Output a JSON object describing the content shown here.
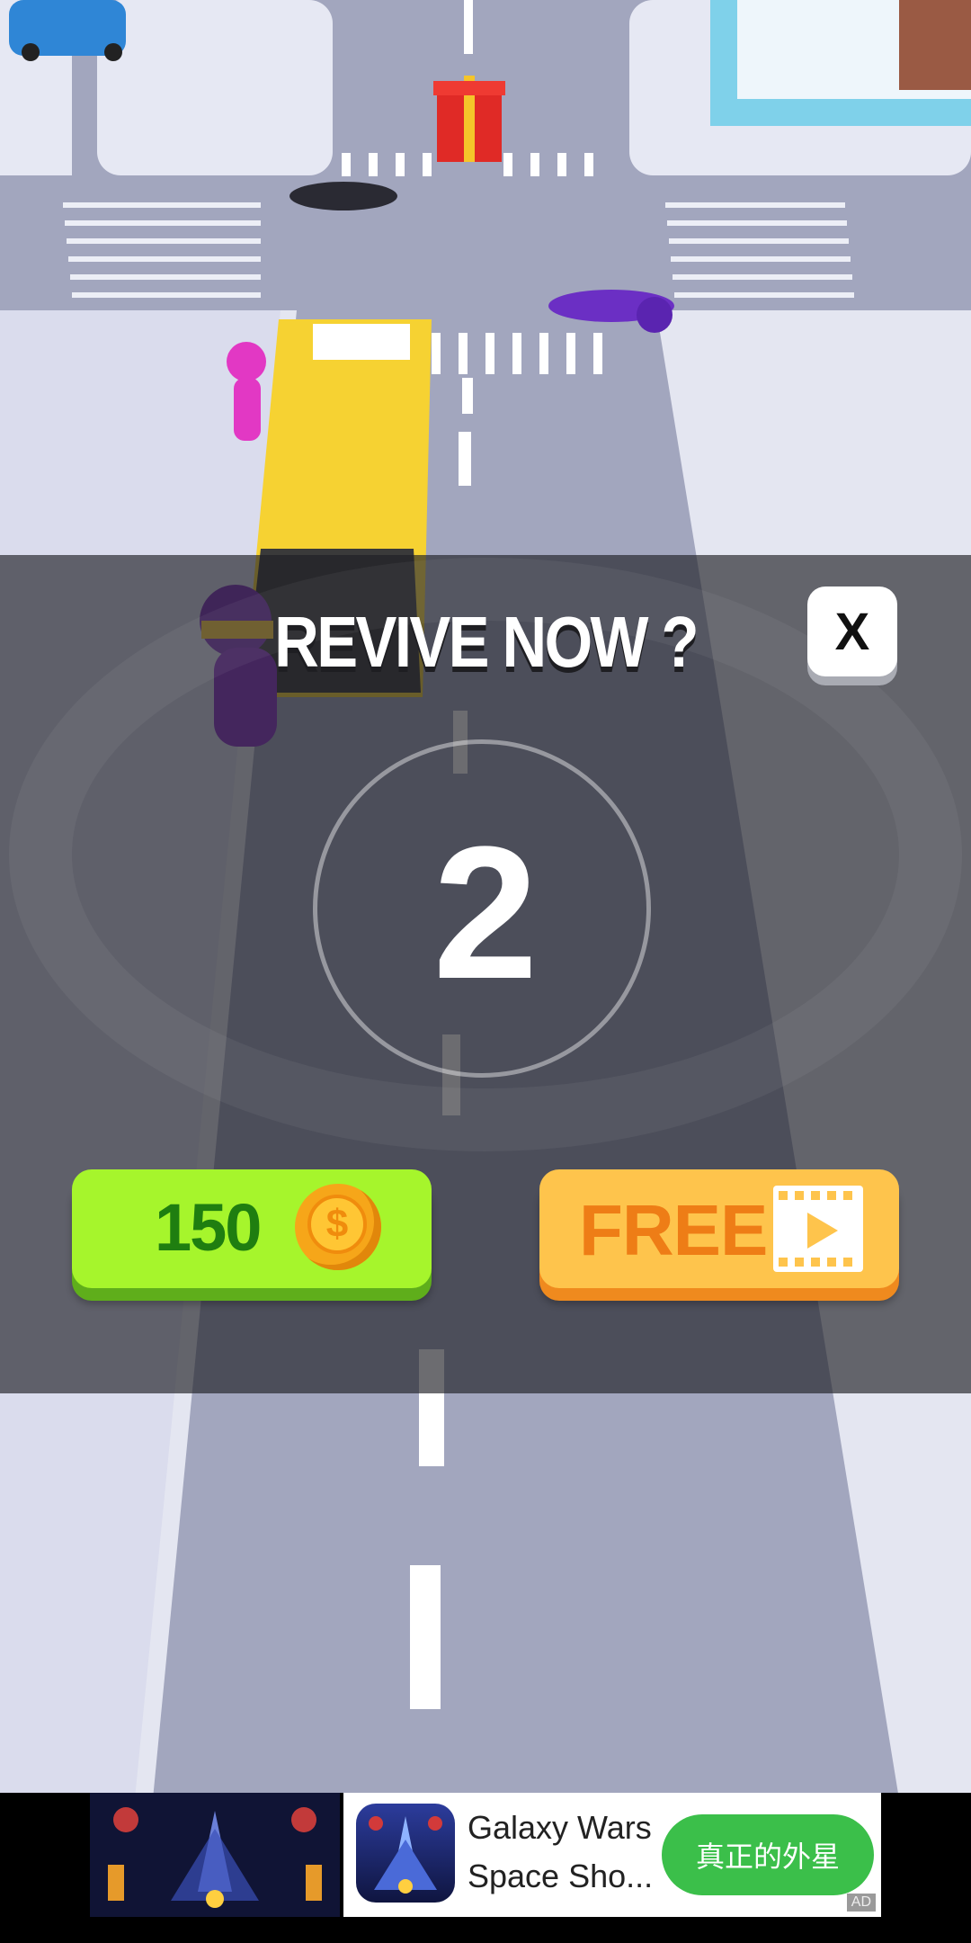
{
  "revive": {
    "title": "REVIVE NOW ?",
    "close_label": "X",
    "countdown": "2"
  },
  "buttons": {
    "coins_label": "150",
    "coin_symbol": "$",
    "coin_icon": "coin-icon",
    "free_label": "FREE",
    "free_icon": "video-play-icon"
  },
  "ad": {
    "title": "Galaxy Wars",
    "subtitle": "Space Sho...",
    "cta_label": "真正的外星",
    "tag": "AD"
  },
  "colors": {
    "coins_button": "#a6f52c",
    "free_button": "#fec44c",
    "cta": "#3bbf4a"
  }
}
